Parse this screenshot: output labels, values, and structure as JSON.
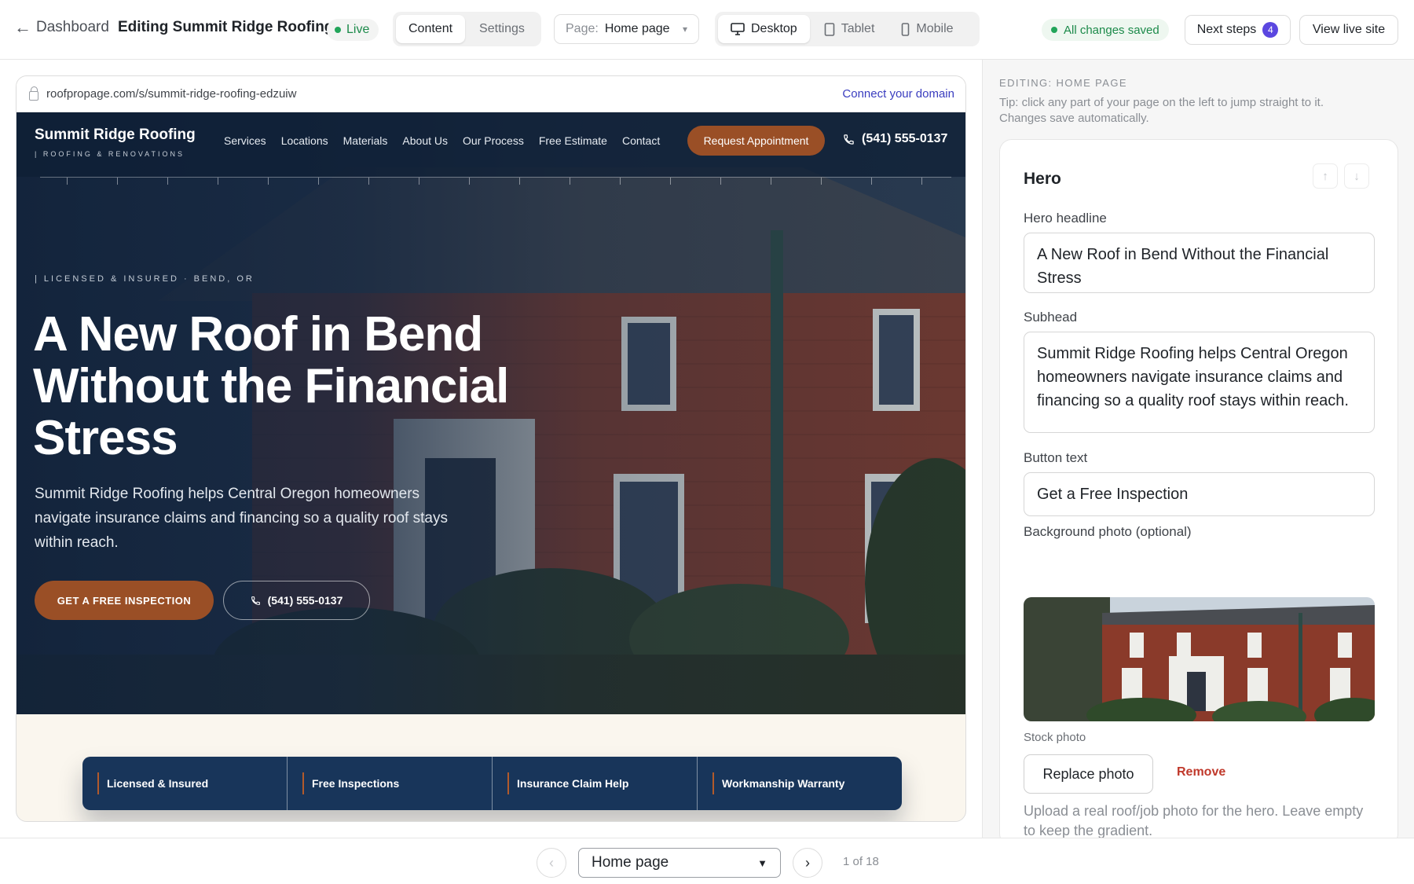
{
  "topbar": {
    "back_label": "Dashboard",
    "title": "Editing Summit Ridge Roofing",
    "live_label": "Live",
    "view_tabs": [
      {
        "label": "Content",
        "active": true
      },
      {
        "label": "Settings",
        "active": false
      }
    ],
    "page_select": {
      "prefix": "Page:",
      "value": "Home page"
    },
    "device_tabs": [
      {
        "label": "Desktop",
        "icon": "monitor-icon",
        "active": true
      },
      {
        "label": "Tablet",
        "icon": "tablet-icon",
        "active": false
      },
      {
        "label": "Mobile",
        "icon": "phone-icon",
        "active": false
      }
    ],
    "saved_label": "All changes saved",
    "next_steps_label": "Next steps",
    "next_steps_count": "4",
    "view_live_label": "View live site"
  },
  "preview": {
    "url": "roofpropage.com/s/summit-ridge-roofing-edzuiw",
    "connect_domain_label": "Connect your domain",
    "site": {
      "logo_name": "Summit Ridge Roofing",
      "logo_tagline": "| ROOFING & RENOVATIONS",
      "nav_links": [
        "Services",
        "Locations",
        "Materials",
        "About Us",
        "Our Process",
        "Free Estimate",
        "Contact"
      ],
      "cta_label": "Request Appointment",
      "phone": "(541) 555-0137",
      "eyebrow": "| LICENSED & INSURED · BEND, OR",
      "headline": "A New Roof in Bend Without the Financial Stress",
      "subhead": "Summit Ridge Roofing helps Central Oregon homeowners navigate insurance claims and financing so a quality roof stays within reach.",
      "primary_button": "GET A FREE INSPECTION",
      "secondary_button": "(541) 555-0137",
      "trust_items": [
        "Licensed & Insured",
        "Free Inspections",
        "Insurance Claim Help",
        "Workmanship Warranty"
      ]
    }
  },
  "panel": {
    "editing_label": "EDITING: HOME PAGE",
    "tip": "Tip: click any part of your page on the left to jump straight to it. Changes save automatically.",
    "section_title": "Hero",
    "fields": {
      "headline": {
        "label": "Hero headline",
        "value": "A New Roof in Bend Without the Financial Stress"
      },
      "subhead": {
        "label": "Subhead",
        "value": "Summit Ridge Roofing helps Central Oregon homeowners navigate insurance claims and financing so a quality roof stays within reach."
      },
      "button_text": {
        "label": "Button text",
        "value": "Get a Free Inspection"
      },
      "background_photo": {
        "label": "Background photo (optional)"
      }
    },
    "photo_caption": "Stock photo",
    "replace_label": "Replace photo",
    "remove_label": "Remove",
    "help_text": "Upload a real roof/job photo for the hero. Leave empty to keep the gradient."
  },
  "bottombar": {
    "page_select_value": "Home page",
    "count_label": "1 of 18"
  },
  "colors": {
    "accent": "#5b47e0",
    "brand_copper": "#9a4f26",
    "navy": "#18355a",
    "success": "#22a55a",
    "danger": "#c0392b"
  }
}
